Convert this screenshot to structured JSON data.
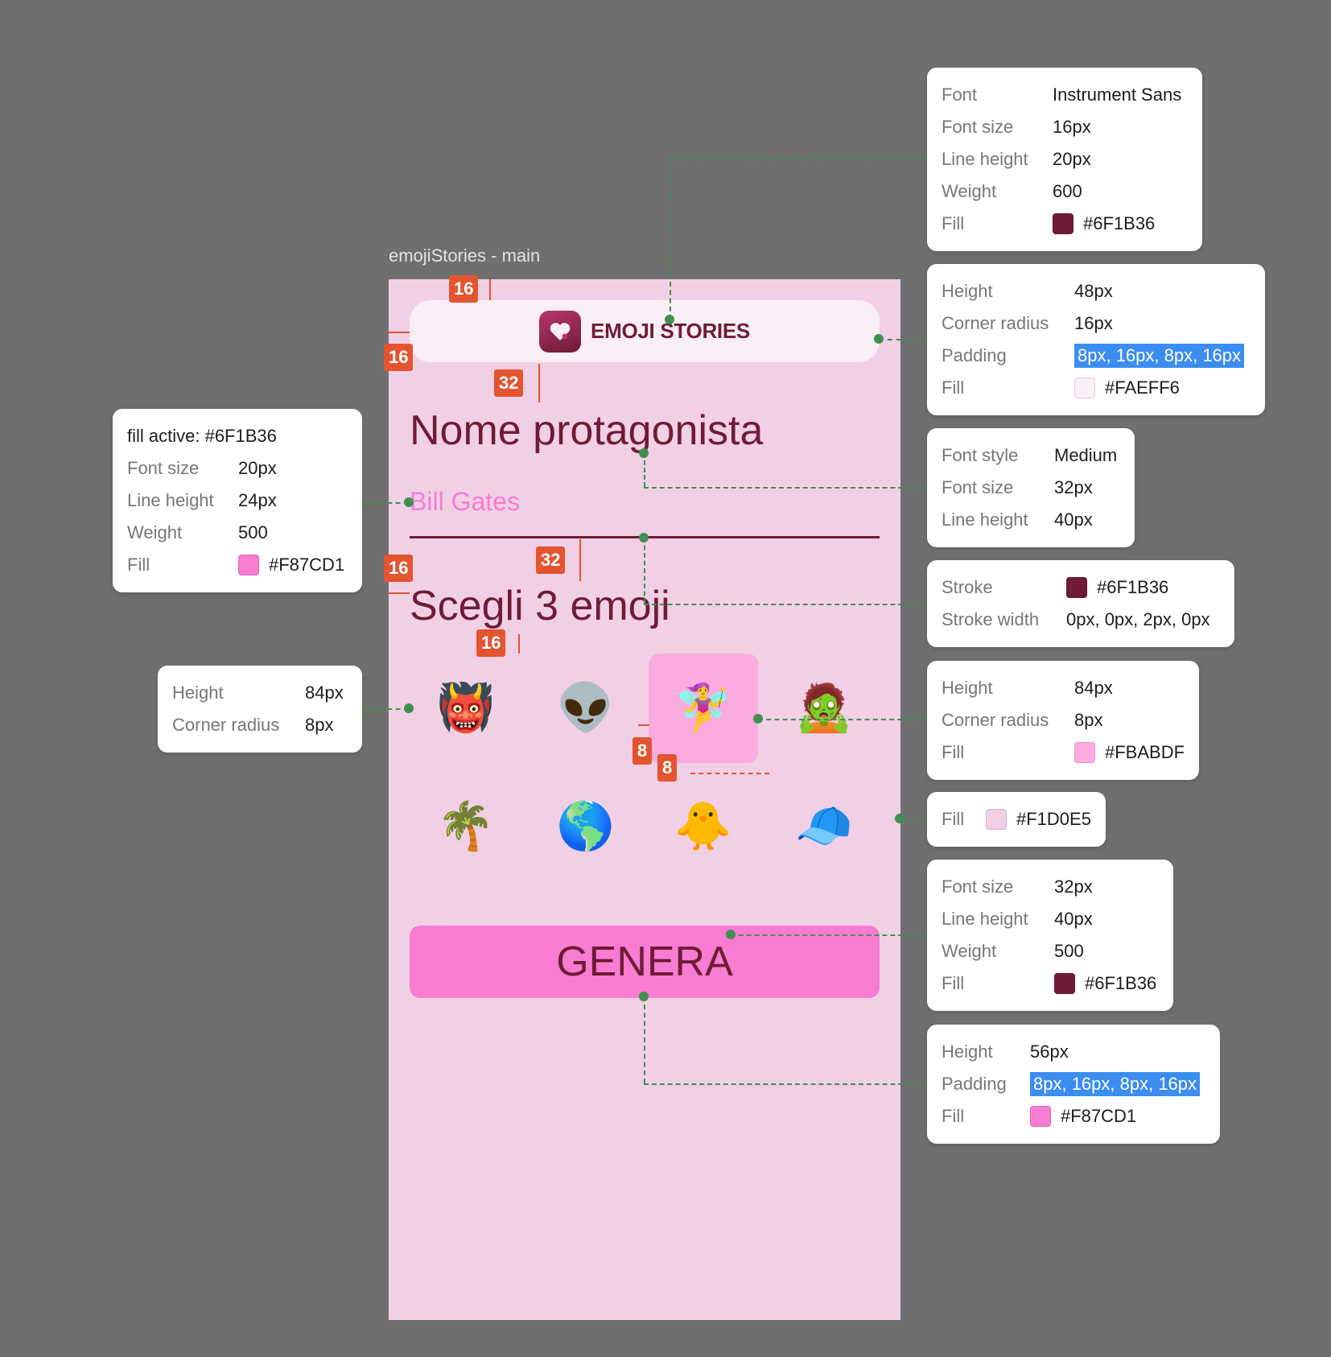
{
  "frame_label": "emojiStories - main",
  "app": {
    "brand": "EMOJI STORIES",
    "name_heading": "Nome protagonista",
    "name_value": "Bill Gates",
    "emoji_heading": "Scegli 3 emoji",
    "generate_label": "GENERA"
  },
  "emoji_grid": [
    {
      "emoji": "👹",
      "selected": false
    },
    {
      "emoji": "👽",
      "selected": false
    },
    {
      "emoji": "🧚‍♀️",
      "selected": true
    },
    {
      "emoji": "🧟",
      "selected": false
    },
    {
      "emoji": "🌴",
      "selected": false
    },
    {
      "emoji": "🌎",
      "selected": false
    },
    {
      "emoji": "🐥",
      "selected": false
    },
    {
      "emoji": "🧢",
      "selected": false
    }
  ],
  "badges": {
    "b16a": "16",
    "b16b": "16",
    "b32a": "32",
    "b32b": "32",
    "b16c": "16",
    "b16d": "16",
    "b8a": "8",
    "b8b": "8"
  },
  "cards": {
    "font_card": {
      "rows": [
        {
          "k": "Font",
          "v": "Instrument Sans"
        },
        {
          "k": "Font size",
          "v": "16px"
        },
        {
          "k": "Line height",
          "v": "20px"
        },
        {
          "k": "Weight",
          "v": "600"
        },
        {
          "k": "Fill",
          "v": "#6F1B36",
          "swatch": "#6F1B36"
        }
      ]
    },
    "header_card": {
      "rows": [
        {
          "k": "Height",
          "v": "48px"
        },
        {
          "k": "Corner radius",
          "v": "16px"
        },
        {
          "k": "Padding",
          "v": "8px, 16px, 8px, 16px",
          "highlight": true
        },
        {
          "k": "Fill",
          "v": "#FAEFF6",
          "swatch": "#FAEFF6"
        }
      ]
    },
    "heading_card": {
      "rows": [
        {
          "k": "Font style",
          "v": "Medium"
        },
        {
          "k": "Font size",
          "v": "32px"
        },
        {
          "k": "Line height",
          "v": "40px"
        }
      ]
    },
    "stroke_card": {
      "rows": [
        {
          "k": "Stroke",
          "v": "#6F1B36",
          "swatch": "#6F1B36"
        },
        {
          "k": "Stroke width",
          "v": "0px, 0px, 2px, 0px"
        }
      ]
    },
    "active_cell_card": {
      "rows": [
        {
          "k": "Height",
          "v": "84px"
        },
        {
          "k": "Corner radius",
          "v": "8px"
        },
        {
          "k": "Fill",
          "v": "#FBABDF",
          "swatch": "#FBABDF"
        }
      ]
    },
    "frame_fill_card": {
      "rows": [
        {
          "k": "Fill",
          "v": "#F1D0E5",
          "swatch": "#F1D0E5"
        }
      ]
    },
    "button_text_card": {
      "rows": [
        {
          "k": "Font size",
          "v": "32px"
        },
        {
          "k": "Line height",
          "v": "40px"
        },
        {
          "k": "Weight",
          "v": "500"
        },
        {
          "k": "Fill",
          "v": "#6F1B36",
          "swatch": "#6F1B36"
        }
      ]
    },
    "button_card": {
      "rows": [
        {
          "k": "Height",
          "v": "56px"
        },
        {
          "k": "Padding",
          "v": "8px, 16px, 8px, 16px",
          "highlight": true
        },
        {
          "k": "Fill",
          "v": "#F87CD1",
          "swatch": "#F87CD1"
        }
      ]
    },
    "name_input_card": {
      "title": "fill active: #6F1B36",
      "rows": [
        {
          "k": "Font size",
          "v": "20px"
        },
        {
          "k": "Line height",
          "v": "24px"
        },
        {
          "k": "Weight",
          "v": "500"
        },
        {
          "k": "Fill",
          "v": "#F87CD1",
          "swatch": "#F87CD1"
        }
      ]
    },
    "cell_card": {
      "rows": [
        {
          "k": "Height",
          "v": "84px"
        },
        {
          "k": "Corner radius",
          "v": "8px"
        }
      ]
    }
  }
}
